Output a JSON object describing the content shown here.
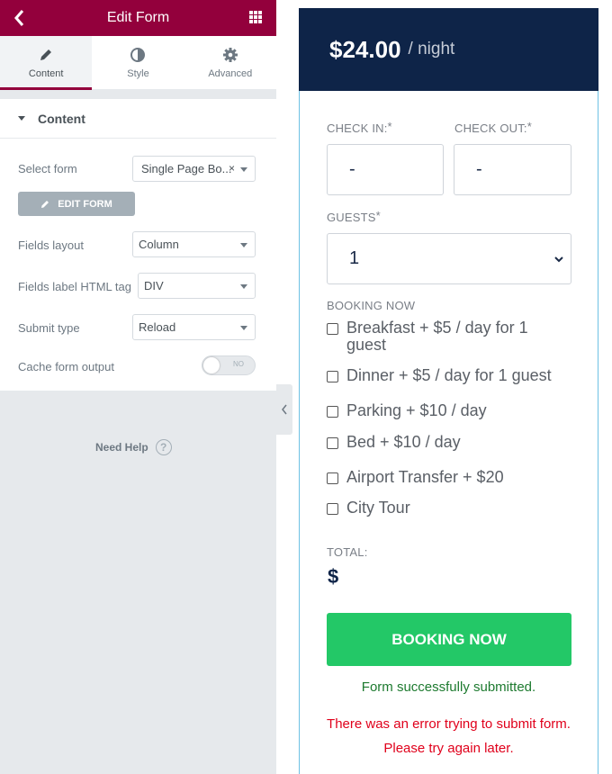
{
  "panel": {
    "title": "Edit Form",
    "tabs": [
      {
        "label": "Content",
        "icon": "pencil-icon"
      },
      {
        "label": "Style",
        "icon": "half-circle-icon"
      },
      {
        "label": "Advanced",
        "icon": "gear-icon"
      }
    ],
    "section_title": "Content",
    "select_form": {
      "label": "Select form",
      "value": "Single Page Bo..."
    },
    "edit_form_button": "EDIT FORM",
    "fields_layout": {
      "label": "Fields layout",
      "value": "Column"
    },
    "fields_label_tag": {
      "label": "Fields label HTML tag",
      "value": "DIV"
    },
    "submit_type": {
      "label": "Submit type",
      "value": "Reload"
    },
    "cache_output": {
      "label": "Cache form output",
      "toggle_label": "NO"
    },
    "need_help": "Need Help",
    "accent_color": "#93003c"
  },
  "booking": {
    "price": "$24.00",
    "per": "/ night",
    "check_in_label": "CHECK IN:",
    "check_in_value": "-",
    "check_out_label": "CHECK OUT:",
    "check_out_value": "-",
    "guests_label": "GUESTS",
    "guests_value": "1",
    "required_mark": "*",
    "booking_now_label": "BOOKING NOW",
    "options": [
      "Breakfast + $5 / day for 1 guest",
      "Dinner + $5 / day for 1 guest",
      "Parking + $10 / day",
      "Bed + $10 / day",
      "Airport Transfer + $20",
      "City Tour"
    ],
    "total_label": "TOTAL:",
    "total_value": "$",
    "button_label": "BOOKING NOW",
    "success_message": "Form successfully submitted.",
    "error_message": "There was an error trying to submit form. Please try again later.",
    "colors": {
      "header": "#0e2448",
      "button": "#23c867",
      "success": "#1d7a2f",
      "error": "#e0001b"
    }
  }
}
